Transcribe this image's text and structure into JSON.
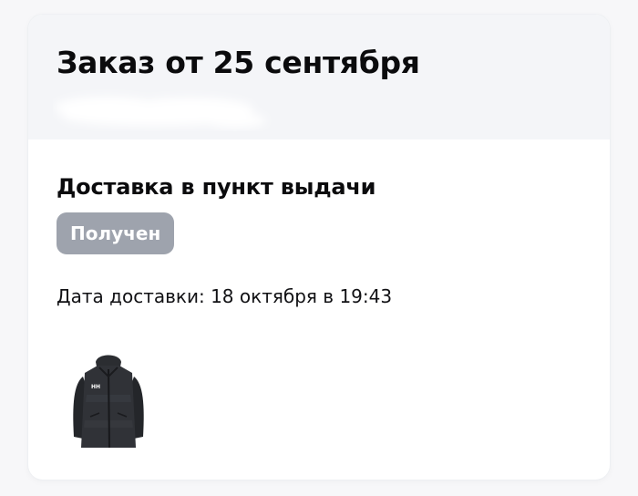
{
  "order": {
    "title": "Заказ от 25 сентября"
  },
  "delivery": {
    "type": "Доставка в пункт выдачи",
    "status": "Получен",
    "date_text": "Дата доставки: 18 октября в 19:43"
  },
  "items": [
    {
      "icon": "jacket-icon",
      "brand_mark": "HH"
    }
  ],
  "colors": {
    "header_bg": "#f4f5f8",
    "status_badge_bg": "#9ea3ad",
    "text_primary": "#0b0b0d"
  }
}
